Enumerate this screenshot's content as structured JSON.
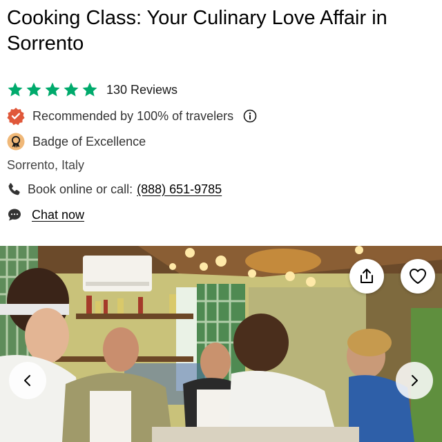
{
  "header": {
    "title": "Cooking Class: Your Culinary Love Affair in Sorrento"
  },
  "rating": {
    "stars": 5,
    "reviews_label": "130 Reviews"
  },
  "recommendation": {
    "text": "Recommended by 100% of travelers",
    "info_icon": "info-icon"
  },
  "badge": {
    "text": "Badge of Excellence"
  },
  "location": {
    "text": "Sorrento, Italy"
  },
  "contact": {
    "book_label": "Book online or call:",
    "phone": "(888) 651-9785"
  },
  "chat": {
    "label": "Chat now"
  },
  "gallery": {
    "share_icon": "share-icon",
    "favorite_icon": "heart-icon",
    "prev_icon": "chevron-left-icon",
    "next_icon": "chevron-right-icon"
  },
  "colors": {
    "star_green": "#00AA6C",
    "recommend_red": "#E0583A",
    "badge_orange": "#F0B878"
  }
}
